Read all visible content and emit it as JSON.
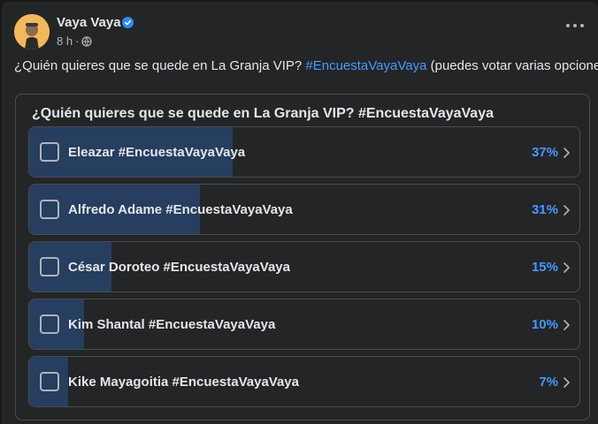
{
  "post": {
    "author": "Vaya Vaya",
    "time": "8 h",
    "separator": "·",
    "text_before": "¿Quién quieres que se quede en La Granja VIP? ",
    "hashtag": "#EncuestaVayaVaya",
    "text_after": " (puedes votar varias opciones)"
  },
  "poll": {
    "title": "¿Quién quieres que se quede en La Granja VIP? #EncuestaVayaVaya",
    "fill_color": "#263e5f",
    "percent_color": "#4599ff",
    "options": [
      {
        "label": "Eleazar #EncuestaVayaVaya",
        "percent_text": "37%",
        "percent": 37
      },
      {
        "label": "Alfredo Adame #EncuestaVayaVaya",
        "percent_text": "31%",
        "percent": 31
      },
      {
        "label": "César Doroteo #EncuestaVayaVaya",
        "percent_text": "15%",
        "percent": 15
      },
      {
        "label": "Kim Shantal #EncuestaVayaVaya",
        "percent_text": "10%",
        "percent": 10
      },
      {
        "label": "Kike Mayagoitia #EncuestaVayaVaya",
        "percent_text": "7%",
        "percent": 7
      }
    ]
  },
  "icons": {
    "verified": "verified-badge-icon",
    "privacy": "globe-icon",
    "more": "more-horizontal-icon",
    "option_arrow": "chevron-right-icon"
  }
}
